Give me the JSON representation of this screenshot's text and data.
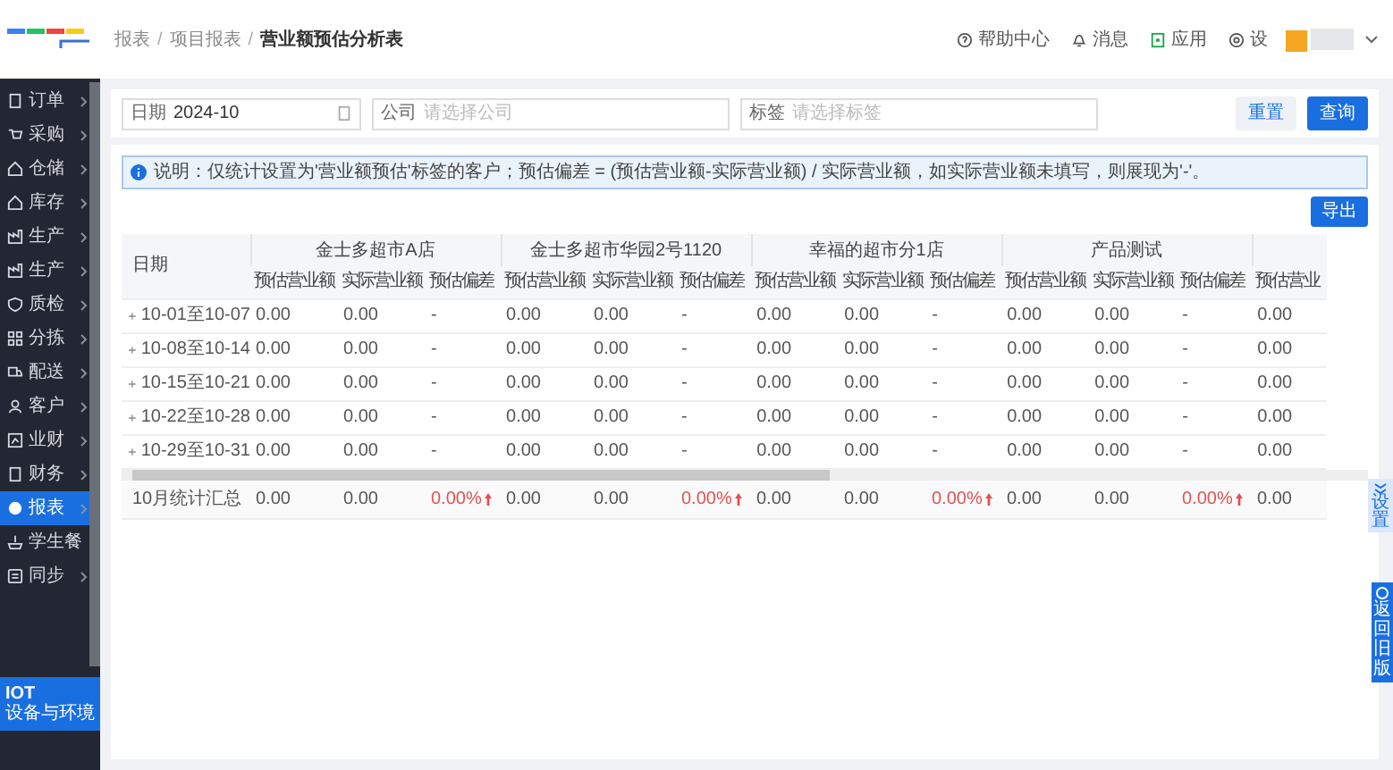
{
  "breadcrumb": {
    "separator": "/",
    "items": [
      {
        "label": "报表",
        "current": false
      },
      {
        "label": "项目报表",
        "current": false
      },
      {
        "label": "营业额预估分析表",
        "current": true
      }
    ]
  },
  "header_links": [
    {
      "label": "帮助中心"
    },
    {
      "label": "消息"
    },
    {
      "label": "应用"
    },
    {
      "label": "设"
    }
  ],
  "sidebar": {
    "items": [
      {
        "label": "订单",
        "has_submenu": true,
        "selected": false
      },
      {
        "label": "采购",
        "has_submenu": true,
        "selected": false
      },
      {
        "label": "仓储",
        "has_submenu": true,
        "selected": false
      },
      {
        "label": "库存",
        "has_submenu": true,
        "selected": false
      },
      {
        "label": "生产",
        "has_submenu": true,
        "selected": false
      },
      {
        "label": "生产",
        "has_submenu": true,
        "selected": false
      },
      {
        "label": "质检",
        "has_submenu": true,
        "selected": false
      },
      {
        "label": "分拣",
        "has_submenu": true,
        "selected": false
      },
      {
        "label": "配送",
        "has_submenu": true,
        "selected": false
      },
      {
        "label": "客户",
        "has_submenu": true,
        "selected": false
      },
      {
        "label": "业财",
        "has_submenu": true,
        "selected": false
      },
      {
        "label": "财务",
        "has_submenu": true,
        "selected": false
      },
      {
        "label": "报表",
        "has_submenu": true,
        "selected": true
      },
      {
        "label": "学生餐",
        "has_submenu": false,
        "selected": false
      },
      {
        "label": "同步",
        "has_submenu": true,
        "selected": false
      }
    ],
    "banner": {
      "title": "IOT",
      "subtitle": "设备与环境"
    }
  },
  "filters": [
    {
      "label": "日期",
      "value": "2024-10",
      "kind": "date"
    },
    {
      "label": "公司",
      "placeholder": "请选择公司",
      "kind": "text"
    },
    {
      "label": "标签",
      "placeholder": "请选择标签",
      "kind": "text"
    }
  ],
  "filter_buttons": [
    {
      "label": "重置",
      "primary": false
    },
    {
      "label": "查询",
      "primary": true
    }
  ],
  "notice": "说明：仅统计设置为'营业额预估'标签的客户；预估偏差 = (预估营业额-实际营业额) / 实际营业额，如实际营业额未填写，则展现为'-'。",
  "export_button": "导出",
  "table": {
    "date_header": "日期",
    "groups": [
      {
        "name": "金士多超市A店",
        "columns": [
          "预估营业额",
          "实际营业额",
          "预估偏差"
        ]
      },
      {
        "name": "金士多超市华园2号1120",
        "columns": [
          "预估营业额",
          "实际营业额",
          "预估偏差"
        ]
      },
      {
        "name": "幸福的超市分1店",
        "columns": [
          "预估营业额",
          "实际营业额",
          "预估偏差"
        ]
      },
      {
        "name": "产品测试",
        "columns": [
          "预估营业额",
          "实际营业额",
          "预估偏差"
        ]
      },
      {
        "columns": [
          "预估营业"
        ]
      }
    ],
    "rows": [
      {
        "date": "10-01至10-07",
        "expandable": true,
        "cells": [
          "0.00",
          "0.00",
          "-",
          "0.00",
          "0.00",
          "-",
          "0.00",
          "0.00",
          "-",
          "0.00",
          "0.00",
          "-",
          "0.00"
        ]
      },
      {
        "date": "10-08至10-14",
        "expandable": true,
        "cells": [
          "0.00",
          "0.00",
          "-",
          "0.00",
          "0.00",
          "-",
          "0.00",
          "0.00",
          "-",
          "0.00",
          "0.00",
          "-",
          "0.00"
        ]
      },
      {
        "date": "10-15至10-21",
        "expandable": true,
        "cells": [
          "0.00",
          "0.00",
          "-",
          "0.00",
          "0.00",
          "-",
          "0.00",
          "0.00",
          "-",
          "0.00",
          "0.00",
          "-",
          "0.00"
        ]
      },
      {
        "date": "10-22至10-28",
        "expandable": true,
        "cells": [
          "0.00",
          "0.00",
          "-",
          "0.00",
          "0.00",
          "-",
          "0.00",
          "0.00",
          "-",
          "0.00",
          "0.00",
          "-",
          "0.00"
        ]
      },
      {
        "date": "10-29至10-31",
        "expandable": true,
        "cells": [
          "0.00",
          "0.00",
          "-",
          "0.00",
          "0.00",
          "-",
          "0.00",
          "0.00",
          "-",
          "0.00",
          "0.00",
          "-",
          "0.00"
        ]
      }
    ],
    "summary": {
      "label": "10月统计汇总",
      "cells": [
        {
          "text": "0.00",
          "rising": false
        },
        {
          "text": "0.00",
          "rising": false
        },
        {
          "text": "0.00%",
          "rising": true
        },
        {
          "text": "0.00",
          "rising": false
        },
        {
          "text": "0.00",
          "rising": false
        },
        {
          "text": "0.00%",
          "rising": true
        },
        {
          "text": "0.00",
          "rising": false
        },
        {
          "text": "0.00",
          "rising": false
        },
        {
          "text": "0.00%",
          "rising": true
        },
        {
          "text": "0.00",
          "rising": false
        },
        {
          "text": "0.00",
          "rising": false
        },
        {
          "text": "0.00%",
          "rising": true
        },
        {
          "text": "0.00",
          "rising": false
        }
      ]
    }
  },
  "column_settings_button": "设置",
  "old_version_button": "返回旧版"
}
